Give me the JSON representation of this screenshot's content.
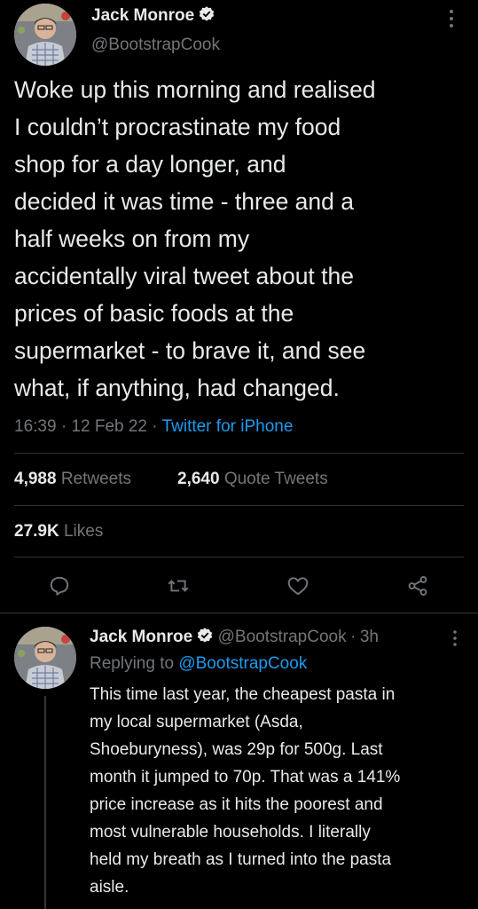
{
  "main_tweet": {
    "display_name": "Jack Monroe",
    "handle": "@BootstrapCook",
    "more_icon": "more-vertical-icon",
    "verified_icon": "verified-badge-icon",
    "text_lines": [
      "Woke up this morning and realised",
      "I couldn’t procrastinate my food",
      "shop for a day longer, and",
      "decided it was time - three and a",
      "half weeks on from my",
      "accidentally viral tweet about the",
      "prices of basic foods at the",
      "supermarket - to brave it, and see",
      "what, if anything, had changed."
    ],
    "time": "16:39",
    "separator": "·",
    "date": "12 Feb 22",
    "source": "Twitter for iPhone",
    "retweets_count": "4,988",
    "retweets_label": "Retweets",
    "quotes_count": "2,640",
    "quotes_label": "Quote Tweets",
    "likes_count": "27.9K",
    "likes_label": "Likes",
    "actions": [
      "reply-icon",
      "retweet-icon",
      "like-icon",
      "share-icon"
    ]
  },
  "reply_tweet": {
    "display_name": "Jack Monroe",
    "handle": "@BootstrapCook",
    "separator": "·",
    "age": "3h",
    "replying_prefix": "Replying to",
    "replying_handle": "@BootstrapCook",
    "text_lines": [
      "This time last year, the cheapest pasta in",
      "my local supermarket (Asda,",
      "Shoeburyness), was 29p for 500g. Last",
      "month it jumped to 70p. That was a 141%",
      "price increase as it hits the poorest and",
      "most vulnerable households. I literally",
      "held my breath as I turned into the pasta",
      "aisle."
    ]
  },
  "colors": {
    "accent": "#1d9bf0",
    "muted": "#71767b",
    "divider": "#2f3336",
    "text": "#e7e9ea",
    "background": "#000000"
  }
}
